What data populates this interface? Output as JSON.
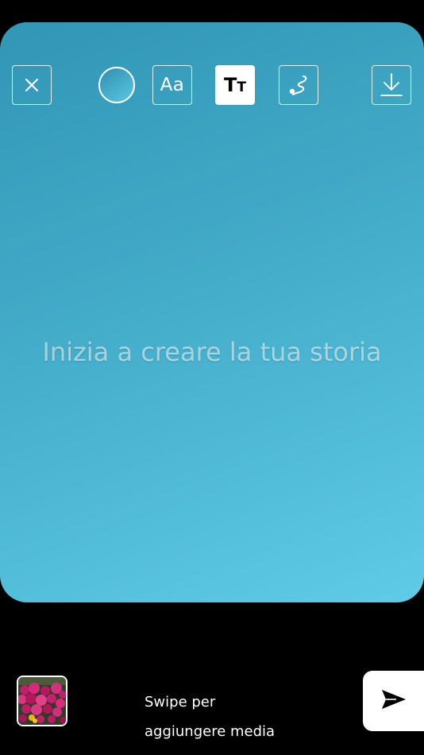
{
  "canvas": {
    "placeholder": "Inizia a creare la tua storia",
    "gradient_start": "#3296b6",
    "gradient_end": "#5fcbe6"
  },
  "toolbar": {
    "close_icon": "close-icon",
    "color_swatch_icon": "color-picker-swatch",
    "font_label": "Aa",
    "text_style_label_big": "T",
    "text_style_label_small": "T",
    "text_style_active": true,
    "draw_icon": "squiggle-draw-icon",
    "download_icon": "download-icon"
  },
  "bottom": {
    "swipe_line1": "Swipe per",
    "swipe_line2": "aggiungere media",
    "thumbnail_icon": "gallery-thumbnail",
    "send_icon": "send-icon"
  }
}
